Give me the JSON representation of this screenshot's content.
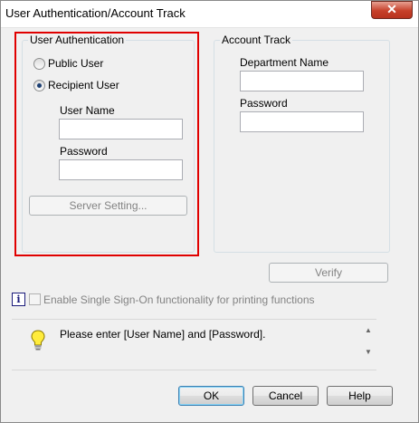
{
  "window": {
    "title": "User Authentication/Account Track",
    "close_glyph": "✕"
  },
  "user_auth": {
    "legend": "User Authentication",
    "public_user_label": "Public User",
    "recipient_user_label": "Recipient User",
    "selected": "recipient",
    "user_name_label": "User Name",
    "user_name_value": "",
    "password_label": "Password",
    "password_value": "",
    "server_setting_label": "Server Setting..."
  },
  "account_track": {
    "legend": "Account Track",
    "department_name_label": "Department Name",
    "department_name_value": "",
    "password_label": "Password",
    "password_value": ""
  },
  "verify_label": "Verify",
  "sso": {
    "info_glyph": "i",
    "label": "Enable Single Sign-On functionality for printing functions",
    "checked": false
  },
  "hint": {
    "text": "Please enter [User Name] and [Password].",
    "icon": "lightbulb-icon"
  },
  "footer": {
    "ok_label": "OK",
    "cancel_label": "Cancel",
    "help_label": "Help"
  },
  "colors": {
    "highlight": "#e00000",
    "accent": "#3c7fb1"
  }
}
